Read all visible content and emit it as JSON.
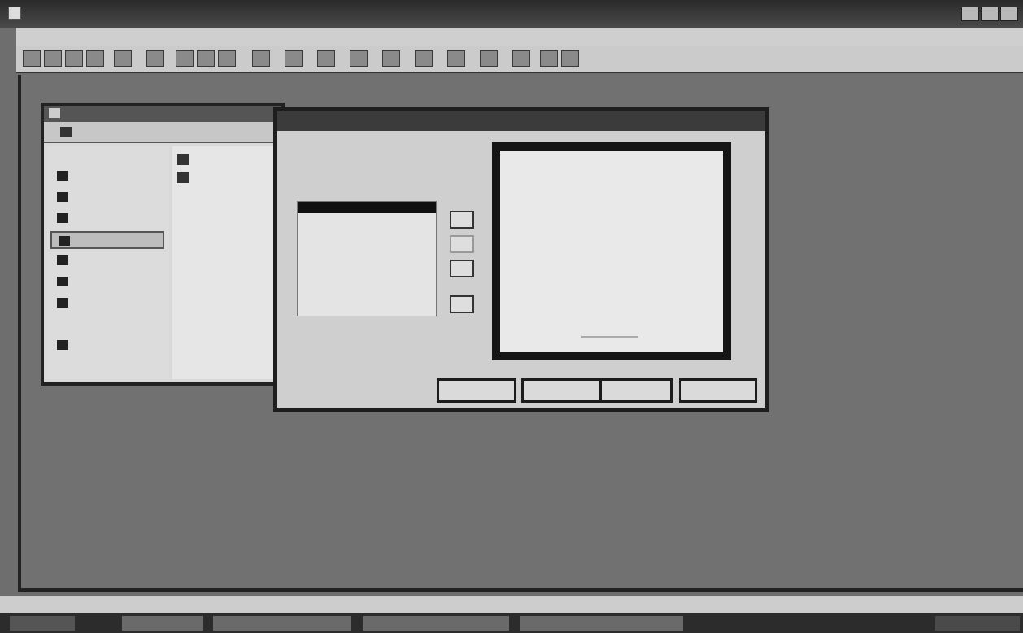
{
  "window": {
    "title": "",
    "search_placeholder": ""
  },
  "menu": {
    "items": [
      "",
      "",
      "",
      "",
      "",
      "",
      ""
    ]
  },
  "workspace": {
    "label_left": "",
    "label_right": ""
  },
  "explorer": {
    "title": "",
    "address": "",
    "nav": [
      "",
      "",
      "",
      "",
      "",
      "",
      "",
      "",
      ""
    ],
    "files": [
      "",
      ""
    ]
  },
  "dialog": {
    "title": "",
    "heading": "",
    "list_header": "",
    "list_items": [
      "",
      "",
      "",
      ""
    ],
    "side_buttons": [
      "",
      "",
      "",
      ""
    ],
    "side_label": "",
    "preview_text": "",
    "help_link": "",
    "buttons": [
      "",
      "",
      "",
      ""
    ]
  },
  "statusbar": {
    "text": ""
  },
  "taskbar": {
    "start": "",
    "items": [
      "",
      "",
      "",
      ""
    ],
    "clock": ""
  }
}
